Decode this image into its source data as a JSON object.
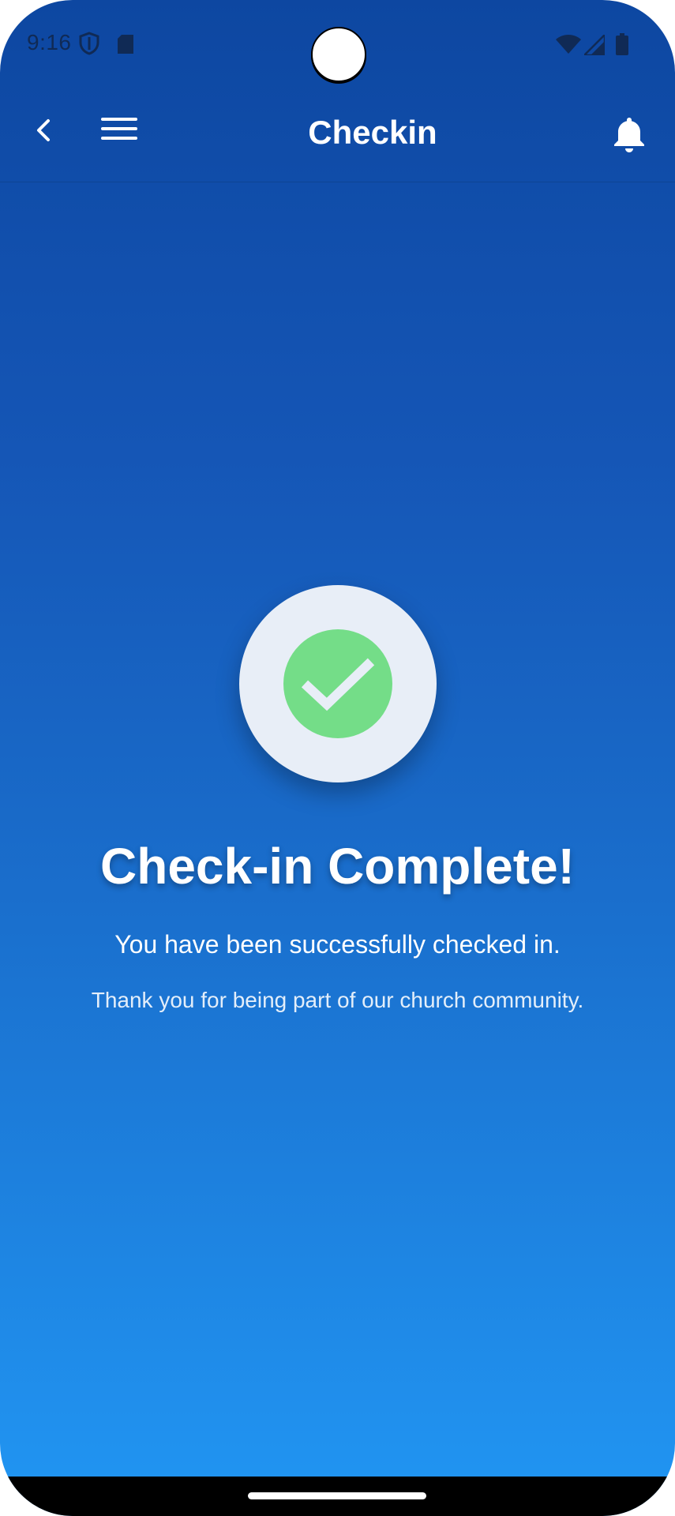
{
  "status_bar": {
    "time": "9:16",
    "icons": [
      "shield-icon",
      "sd-card-icon",
      "wifi-icon",
      "cell-signal-icon",
      "battery-icon"
    ]
  },
  "app_bar": {
    "title": "Checkin",
    "icons": [
      "back-arrow-icon",
      "hamburger-menu-icon",
      "bell-icon"
    ]
  },
  "content": {
    "headline": "Check-in Complete!",
    "message": "You have been successfully checked in.",
    "submessage": "Thank you for being part of our church community.",
    "icon": "checkmark-icon"
  },
  "colors": {
    "gradient_top": "#0d47a1",
    "gradient_bottom": "#2196f3",
    "success_green": "#74dd88",
    "badge_bg": "#e8eef7"
  }
}
